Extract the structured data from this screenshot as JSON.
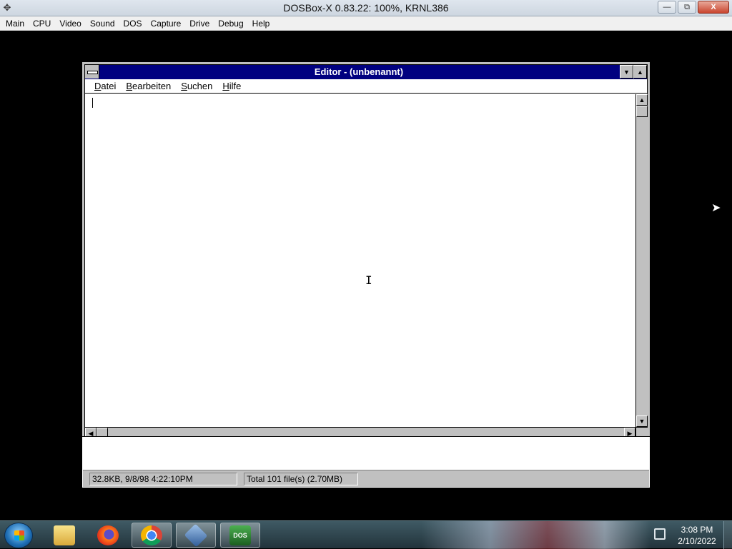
{
  "host": {
    "title": "DOSBox-X 0.83.22: 100%, KRNL386",
    "icon": "dosbox-app-icon",
    "minimize": "—",
    "restore": "⧉",
    "close": "X",
    "menu": [
      "Main",
      "CPU",
      "Video",
      "Sound",
      "DOS",
      "Capture",
      "Drive",
      "Debug",
      "Help"
    ]
  },
  "editor": {
    "title": "Editor - (unbenannt)",
    "min_glyph": "▼",
    "max_glyph": "▲",
    "menu": [
      {
        "ul": "D",
        "rest": "atei"
      },
      {
        "ul": "B",
        "rest": "earbeiten"
      },
      {
        "ul": "S",
        "rest": "uchen"
      },
      {
        "ul": "H",
        "rest": "ilfe"
      }
    ],
    "content": "",
    "scroll_up": "▲",
    "scroll_down": "▼",
    "scroll_left": "◀",
    "scroll_right": "▶",
    "ibeam": "I"
  },
  "status": {
    "left": "32.8KB, 9/8/98 4:22:10PM",
    "right": "Total 101 file(s) (2.70MB)"
  },
  "taskbar": {
    "apps": [
      {
        "name": "windows-explorer",
        "glyph": ""
      },
      {
        "name": "firefox",
        "glyph": ""
      },
      {
        "name": "chrome",
        "glyph": ""
      },
      {
        "name": "virtualbox",
        "glyph": ""
      },
      {
        "name": "dosbox",
        "glyph": "DOS"
      }
    ],
    "time": "3:08 PM",
    "date": "2/10/2022"
  },
  "colors": {
    "win31_title_bg": "#000080",
    "win31_face": "#c0c0c0",
    "desktop_bg": "#000000"
  }
}
